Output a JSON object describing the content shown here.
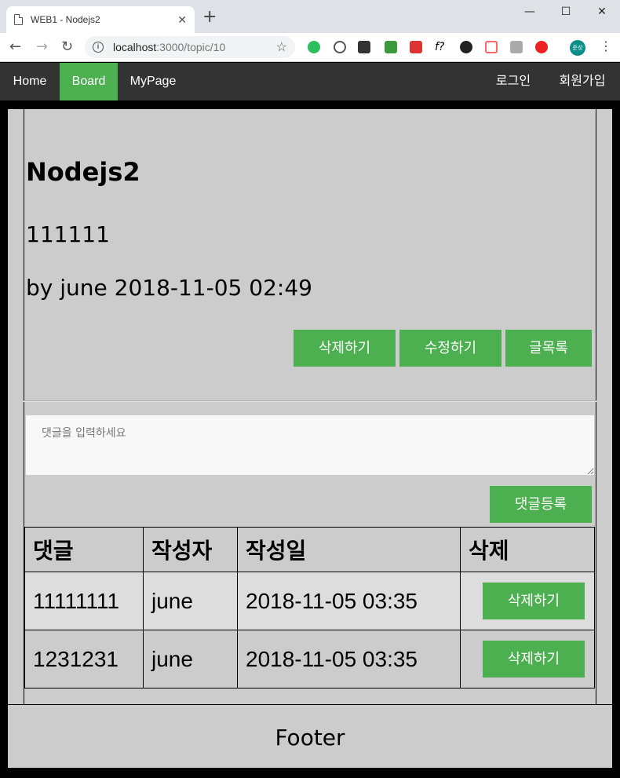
{
  "browser": {
    "tab_title": "WEB1 - Nodejs2",
    "tab_close": "✕",
    "new_tab": "+",
    "url_host": "localhost",
    "url_path": ":3000/topic/10",
    "minimize": "—",
    "maximize": "☐",
    "close": "✕",
    "back": "←",
    "forward": "→",
    "reload": "↻",
    "star": "☆",
    "menu": "⋮",
    "avatar_label": "준성"
  },
  "nav": {
    "left": [
      {
        "label": "Home"
      },
      {
        "label": "Board"
      },
      {
        "label": "MyPage"
      }
    ],
    "right": [
      {
        "label": "로그인"
      },
      {
        "label": "회원가입"
      }
    ],
    "active_color": "#4caf50"
  },
  "post": {
    "title": "Nodejs2",
    "body": "111111",
    "meta": "by june 2018-11-05 02:49",
    "buttons": {
      "delete": "삭제하기",
      "edit": "수정하기",
      "list": "글목록"
    }
  },
  "comment_form": {
    "placeholder": "댓글을 입력하세요",
    "submit": "댓글등록"
  },
  "comments": {
    "headers": [
      "댓글",
      "작성자",
      "작성일",
      "삭제"
    ],
    "rows": [
      {
        "text": "11111111",
        "author": "june",
        "date": "2018-11-05 03:35",
        "delete": "삭제하기"
      },
      {
        "text": "1231231",
        "author": "june",
        "date": "2018-11-05 03:35",
        "delete": "삭제하기"
      }
    ]
  },
  "footer": "Footer"
}
